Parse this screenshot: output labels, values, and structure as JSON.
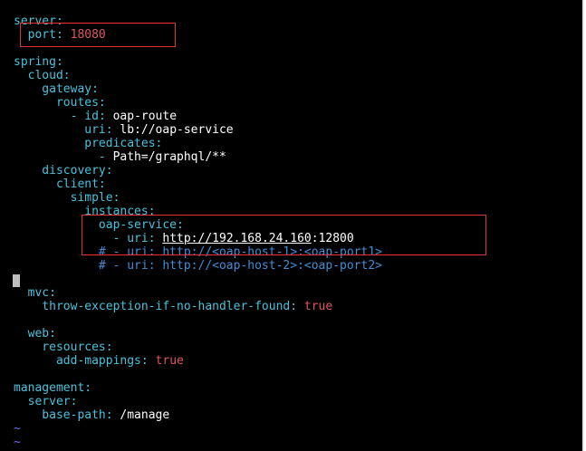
{
  "editor": {
    "lines": [
      {
        "i": 0,
        "key": "server",
        "sep": ":",
        "val": ""
      },
      {
        "i": 1,
        "key": "  port",
        "sep": ": ",
        "num": "18080"
      },
      {
        "i": 3,
        "key": "spring",
        "sep": ":"
      },
      {
        "i": 4,
        "key": "  cloud",
        "sep": ":"
      },
      {
        "i": 5,
        "key": "    gateway",
        "sep": ":"
      },
      {
        "i": 6,
        "key": "      routes",
        "sep": ":"
      },
      {
        "i": 7,
        "pre": "        - ",
        "key": "id",
        "sep": ": ",
        "val": "oap-route"
      },
      {
        "i": 8,
        "key": "          uri",
        "sep": ": ",
        "val": "lb://oap-service"
      },
      {
        "i": 9,
        "key": "          predicates",
        "sep": ":"
      },
      {
        "i": 10,
        "pre": "            - ",
        "val": "Path=/graphql/**"
      },
      {
        "i": 11,
        "key": "    discovery",
        "sep": ":"
      },
      {
        "i": 12,
        "key": "      client",
        "sep": ":"
      },
      {
        "i": 13,
        "key": "        simple",
        "sep": ":"
      },
      {
        "i": 14,
        "key": "          instances",
        "sep": ":"
      },
      {
        "i": 15,
        "key": "            oap-service",
        "sep": ":"
      },
      {
        "i": 16,
        "pre": "              - ",
        "key": "uri",
        "sep": ": ",
        "url": "http://192.168.24.160",
        "val": ":12800"
      },
      {
        "i": 17,
        "comment": "            # - uri: http://<oap-host-1>:<oap-port1>"
      },
      {
        "i": 18,
        "comment": "            # - uri: http://<oap-host-2>:<oap-port2>"
      },
      {
        "i": 20,
        "key": "  mvc",
        "sep": ":"
      },
      {
        "i": 21,
        "key": "    throw-exception-if-no-handler-found",
        "sep": ": ",
        "num": "true"
      },
      {
        "i": 23,
        "key": "  web",
        "sep": ":"
      },
      {
        "i": 24,
        "key": "    resources",
        "sep": ":"
      },
      {
        "i": 25,
        "key": "      add-mappings",
        "sep": ": ",
        "num": "true"
      },
      {
        "i": 27,
        "key": "management",
        "sep": ":"
      },
      {
        "i": 28,
        "key": "  server",
        "sep": ":"
      },
      {
        "i": 29,
        "key": "    base-path",
        "sep": ": ",
        "val": "/manage"
      },
      {
        "i": 30,
        "tilde": "~"
      },
      {
        "i": 31,
        "tilde": "~"
      }
    ]
  },
  "colors": {
    "background": "#000000",
    "key": "#49c2dc",
    "number": "#e05561",
    "comment": "#3f8fd8",
    "highlight_box": "#e03434"
  }
}
